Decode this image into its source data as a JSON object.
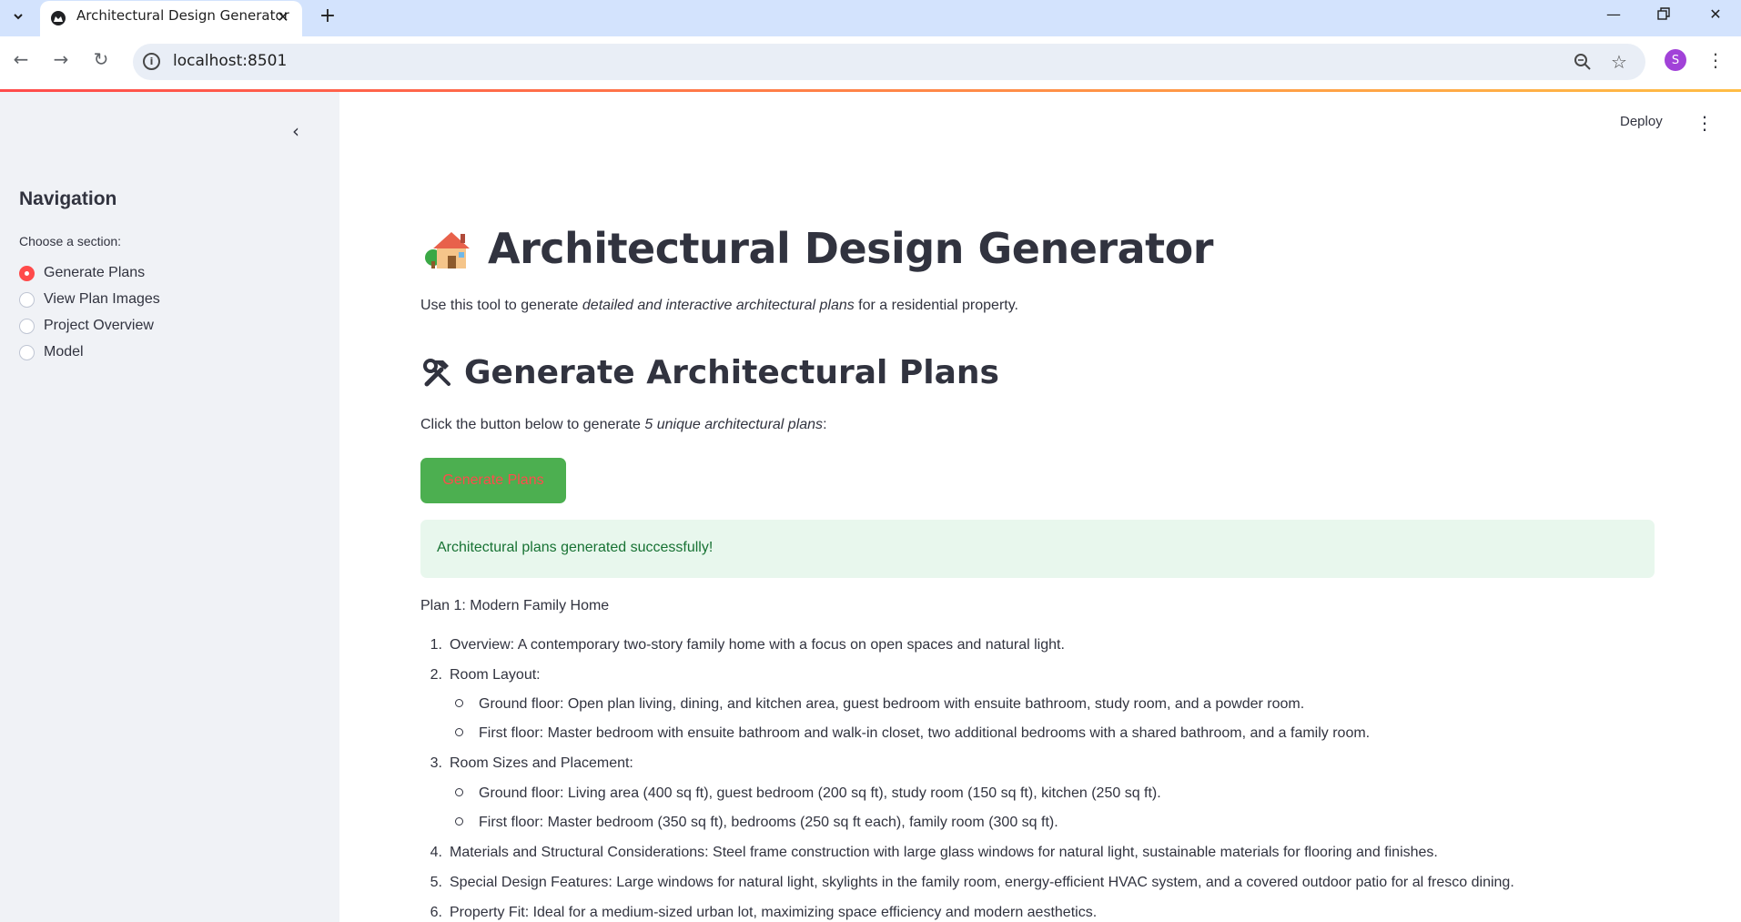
{
  "browser": {
    "tab_title": "Architectural Design Generator",
    "url": "localhost:8501",
    "profile_initial": "S"
  },
  "sidebar": {
    "title": "Navigation",
    "radio_label": "Choose a section:",
    "options": [
      "Generate Plans",
      "View Plan Images",
      "Project Overview",
      "Model"
    ],
    "selected": "Generate Plans"
  },
  "header": {
    "deploy_label": "Deploy"
  },
  "main": {
    "title": "Architectural Design Generator",
    "intro_before": "Use this tool to generate ",
    "intro_em": "detailed and interactive architectural plans",
    "intro_after": " for a residential property.",
    "section_title": "Generate Architectural Plans",
    "instruction_before": "Click the button below to generate ",
    "instruction_em": "5 unique architectural plans",
    "instruction_after": ":",
    "button_label": "Generate Plans",
    "success_message": "Architectural plans generated successfully!",
    "plan_title": "Plan 1: Modern Family Home",
    "items": [
      {
        "num": "1.",
        "text": "Overview: A contemporary two-story family home with a focus on open spaces and natural light."
      },
      {
        "num": "2.",
        "text": "Room Layout:"
      },
      {
        "num": "",
        "text": "Ground floor: Open plan living, dining, and kitchen area, guest bedroom with ensuite bathroom, study room, and a powder room."
      },
      {
        "num": "",
        "text": "First floor: Master bedroom with ensuite bathroom and walk-in closet, two additional bedrooms with a shared bathroom, and a family room."
      },
      {
        "num": "3.",
        "text": "Room Sizes and Placement:"
      },
      {
        "num": "",
        "text": "Ground floor: Living area (400 sq ft), guest bedroom (200 sq ft), study room (150 sq ft), kitchen (250 sq ft)."
      },
      {
        "num": "",
        "text": "First floor: Master bedroom (350 sq ft), bedrooms (250 sq ft each), family room (300 sq ft)."
      },
      {
        "num": "4.",
        "text": "Materials and Structural Considerations: Steel frame construction with large glass windows for natural light, sustainable materials for flooring and finishes."
      },
      {
        "num": "5.",
        "text": "Special Design Features: Large windows for natural light, skylights in the family room, energy-efficient HVAC system, and a covered outdoor patio for al fresco dining."
      },
      {
        "num": "6.",
        "text": "Property Fit: Ideal for a medium-sized urban lot, maximizing space efficiency and modern aesthetics."
      }
    ]
  },
  "colors": {
    "accent": "#ff4b4b",
    "button_bg": "#4caf50",
    "success_bg": "#e8f7ed",
    "success_text": "#177233",
    "sidebar_bg": "#f0f2f6"
  },
  "icons": {
    "house": "house-with-garden-icon",
    "tools": "hammer-and-wrench-icon"
  }
}
